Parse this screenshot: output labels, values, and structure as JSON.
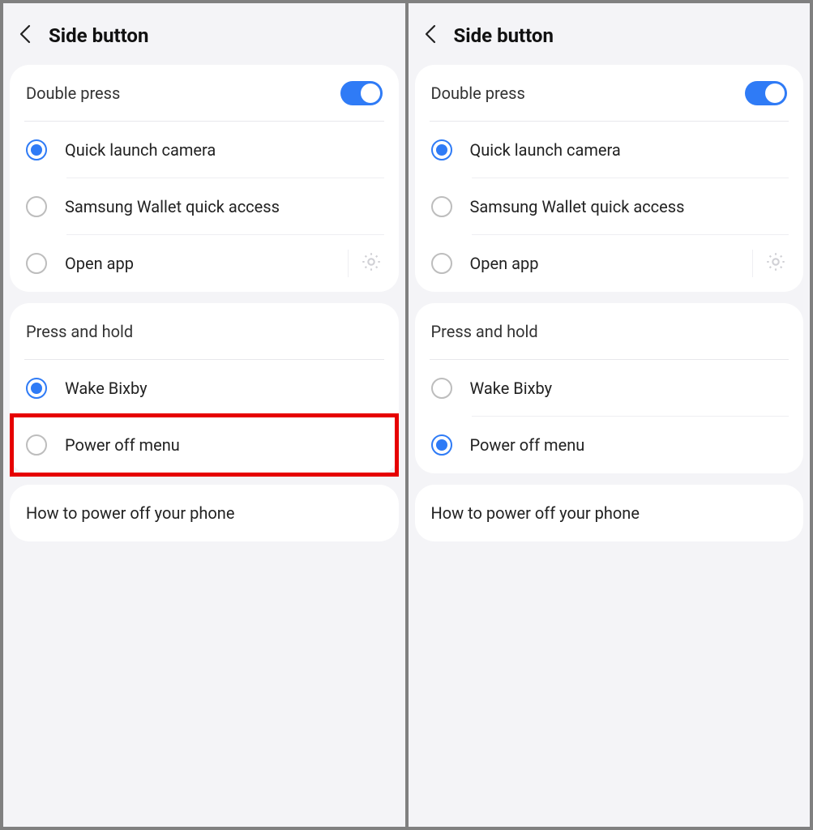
{
  "left": {
    "header": {
      "title": "Side button"
    },
    "double_press": {
      "title": "Double press",
      "toggle_on": true,
      "options": [
        {
          "label": "Quick launch camera",
          "selected": true,
          "gear": false
        },
        {
          "label": "Samsung Wallet quick access",
          "selected": false,
          "gear": false
        },
        {
          "label": "Open app",
          "selected": false,
          "gear": true
        }
      ]
    },
    "press_hold": {
      "title": "Press and hold",
      "options": [
        {
          "label": "Wake Bixby",
          "selected": true,
          "highlight": false
        },
        {
          "label": "Power off menu",
          "selected": false,
          "highlight": true
        }
      ]
    },
    "info": {
      "label": "How to power off your phone"
    }
  },
  "right": {
    "header": {
      "title": "Side button"
    },
    "double_press": {
      "title": "Double press",
      "toggle_on": true,
      "options": [
        {
          "label": "Quick launch camera",
          "selected": true,
          "gear": false
        },
        {
          "label": "Samsung Wallet quick access",
          "selected": false,
          "gear": false
        },
        {
          "label": "Open app",
          "selected": false,
          "gear": true
        }
      ]
    },
    "press_hold": {
      "title": "Press and hold",
      "options": [
        {
          "label": "Wake Bixby",
          "selected": false,
          "highlight": false
        },
        {
          "label": "Power off menu",
          "selected": true,
          "highlight": false
        }
      ]
    },
    "info": {
      "label": "How to power off your phone"
    }
  }
}
